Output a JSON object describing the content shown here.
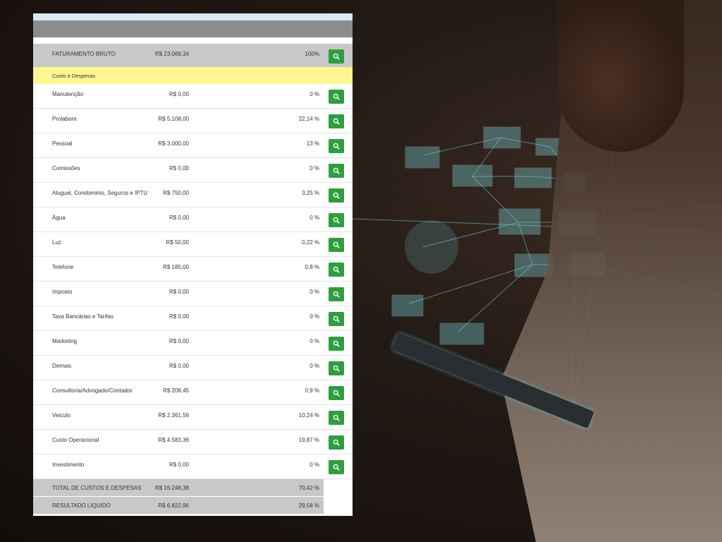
{
  "header": {
    "title": ""
  },
  "faturamento": {
    "label": "FATURAMENTO BRUTO",
    "value": "R$ 23.069,34",
    "pct": "100%"
  },
  "section": {
    "label": "Custo e Despesas"
  },
  "expenses": [
    {
      "label": "Manutenção",
      "value": "R$ 0,00",
      "pct": "0 %"
    },
    {
      "label": "Prolabore",
      "value": "R$ 5.108,00",
      "pct": "22,14 %"
    },
    {
      "label": "Pessoal",
      "value": "R$ 3.000,00",
      "pct": "13 %"
    },
    {
      "label": "Comissões",
      "value": "R$ 0,00",
      "pct": "0 %"
    },
    {
      "label": "Aluguel, Condominio, Seguros e IPTU",
      "value": "R$ 750,00",
      "pct": "3,25 %"
    },
    {
      "label": "Água",
      "value": "R$ 0,00",
      "pct": "0 %"
    },
    {
      "label": "Luz",
      "value": "R$ 50,00",
      "pct": "0,22 %"
    },
    {
      "label": "Telefone",
      "value": "R$ 185,00",
      "pct": "0,8 %"
    },
    {
      "label": "Imposto",
      "value": "R$ 0,00",
      "pct": "0 %"
    },
    {
      "label": "Taxa Bancárias e Tarifas",
      "value": "R$ 0,00",
      "pct": "0 %"
    },
    {
      "label": "Marketing",
      "value": "R$ 0,00",
      "pct": "0 %"
    },
    {
      "label": "Demais",
      "value": "R$ 0,00",
      "pct": "0 %"
    },
    {
      "label": "Consultoria/Advogado/Contador",
      "value": "R$ 208,45",
      "pct": "0,9 %"
    },
    {
      "label": "Veiculo",
      "value": "R$ 2.361,56",
      "pct": "10,24 %"
    },
    {
      "label": "Custo Operacional",
      "value": "R$ 4.583,36",
      "pct": "19,87 %"
    },
    {
      "label": "Investimento",
      "value": "R$ 0,00",
      "pct": "0 %"
    }
  ],
  "totals": {
    "custos": {
      "label": "TOTAL DE CUSTOS E DESPESAS",
      "value": "R$ 16.246,38",
      "pct": "70,42 %"
    },
    "resultado": {
      "label": "RESULTADO LIQUIDO",
      "value": "R$ 6.822,96",
      "pct": "29,58 %"
    }
  },
  "colors": {
    "button": "#2e9e3e",
    "section": "#fdf691",
    "total": "#c8c8c8"
  },
  "icons": {
    "detail_button": "search-icon"
  }
}
